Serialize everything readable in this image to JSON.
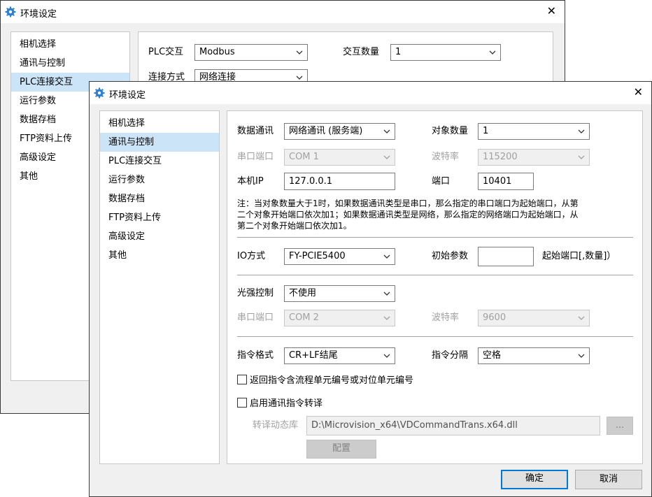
{
  "back_window": {
    "title": "环境设定",
    "nav_items": [
      "相机选择",
      "通讯与控制",
      "PLC连接交互",
      "运行参数",
      "数据存档",
      "FTP资料上传",
      "高级设定",
      "其他"
    ],
    "selected_index": 2,
    "plc_interaction": {
      "label": "PLC交互",
      "value": "Modbus"
    },
    "interaction_count": {
      "label": "交互数量",
      "value": "1"
    },
    "connection_mode": {
      "label": "连接方式",
      "value": "网络连接"
    }
  },
  "front_window": {
    "title": "环境设定",
    "nav_items": [
      "相机选择",
      "通讯与控制",
      "PLC连接交互",
      "运行参数",
      "数据存档",
      "FTP资料上传",
      "高级设定",
      "其他"
    ],
    "selected_index": 1,
    "data_comm": {
      "label": "数据通讯",
      "value": "网络通讯 (服务端)"
    },
    "object_count": {
      "label": "对象数量",
      "value": "1"
    },
    "serial_port_1": {
      "label": "串口端口",
      "value": "COM 1"
    },
    "baud_rate_1": {
      "label": "波特率",
      "value": "115200"
    },
    "local_ip": {
      "label": "本机IP",
      "value": "127.0.0.1"
    },
    "port": {
      "label": "端口",
      "value": "10401"
    },
    "note_lines": [
      "注：当对象数量大于1时，如果数据通讯类型是串口，那么指定的串口端口为起始端口，从第",
      "二个对象开始端口依次加1；如果数据通讯类型是网络，那么指定的网络端口为起始端口，从",
      "第二个对象开始端口依次加1。"
    ],
    "io_mode": {
      "label": "IO方式",
      "value": "FY-PCIE5400"
    },
    "init_params": {
      "label": "初始参数",
      "value": "",
      "hint": "起始端口[,数量]）"
    },
    "light_control": {
      "label": "光强控制",
      "value": "不使用"
    },
    "serial_port_2": {
      "label": "串口端口",
      "value": "COM 2"
    },
    "baud_rate_2": {
      "label": "波特率",
      "value": "9600"
    },
    "cmd_format": {
      "label": "指令格式",
      "value": "CR+LF结尾"
    },
    "cmd_separator": {
      "label": "指令分隔",
      "value": "空格"
    },
    "return_flow_checkbox": {
      "label": "返回指令含流程单元编号或对位单元编号",
      "checked": false
    },
    "enable_translate_checkbox": {
      "label": "启用通讯指令转译",
      "checked": false
    },
    "translate_lib": {
      "label": "转译动态库",
      "value": "D:\\Microvision_x64\\VDCommandTrans.x64.dll",
      "browse": "..."
    },
    "config_button": "配置",
    "ok_button": "确定",
    "cancel_button": "取消"
  },
  "colors": {
    "selection": "#cce4f7",
    "accent": "#0078d7",
    "gear": "#2d7fd3"
  }
}
